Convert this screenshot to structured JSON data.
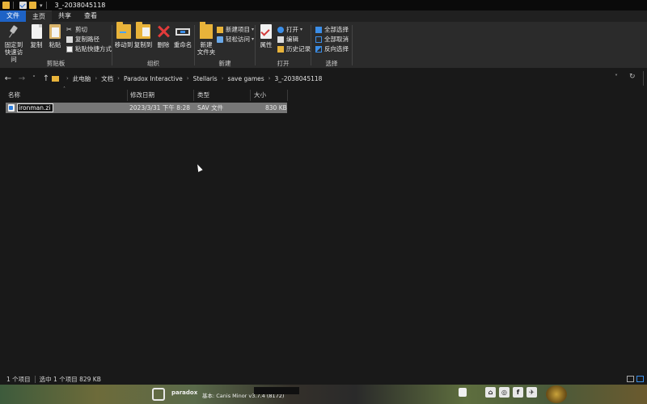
{
  "window": {
    "title": "3_-2038045118"
  },
  "ribbon_tabs": [
    "文件",
    "主页",
    "共享",
    "查看"
  ],
  "ribbon": {
    "clipboard": {
      "pin_label_1": "固定到",
      "pin_label_2": "快速访问",
      "copy_label": "复制",
      "paste_label": "粘贴",
      "cut_label": "剪切",
      "copy_path_label": "复制路径",
      "paste_shortcut_label": "粘贴快捷方式",
      "group_label": "剪贴板"
    },
    "organize": {
      "move_to_label": "移动到",
      "copy_to_label": "复制到",
      "delete_label": "删除",
      "rename_label": "重命名",
      "group_label": "组织"
    },
    "new": {
      "new_folder_label_1": "新建",
      "new_folder_label_2": "文件夹",
      "new_item_label": "新建项目",
      "easy_access_label": "轻松访问",
      "group_label": "新建"
    },
    "open": {
      "properties_label": "属性",
      "open_label": "打开",
      "edit_label": "编辑",
      "history_label": "历史记录",
      "group_label": "打开"
    },
    "select": {
      "select_all_label": "全部选择",
      "select_none_label": "全部取消",
      "invert_label": "反向选择",
      "group_label": "选择"
    }
  },
  "address": {
    "crumbs": [
      "此电脑",
      "文档",
      "Paradox Interactive",
      "Stellaris",
      "save games",
      "3_-2038045118"
    ]
  },
  "columns": {
    "name": "名称",
    "date": "修改日期",
    "type": "类型",
    "size": "大小"
  },
  "files": [
    {
      "name_editing": "ironman.zi",
      "date": "2023/3/31 下午 8:28",
      "type": "SAV 文件",
      "size": "830 KB"
    }
  ],
  "status": {
    "count": "1 个项目",
    "selected": "选中 1 个项目  829 KB"
  },
  "taskbar": {
    "brand": "paradox",
    "version": "基本: Canis Minor v3.7.4 (8172)",
    "facebook_glyph": "f"
  }
}
